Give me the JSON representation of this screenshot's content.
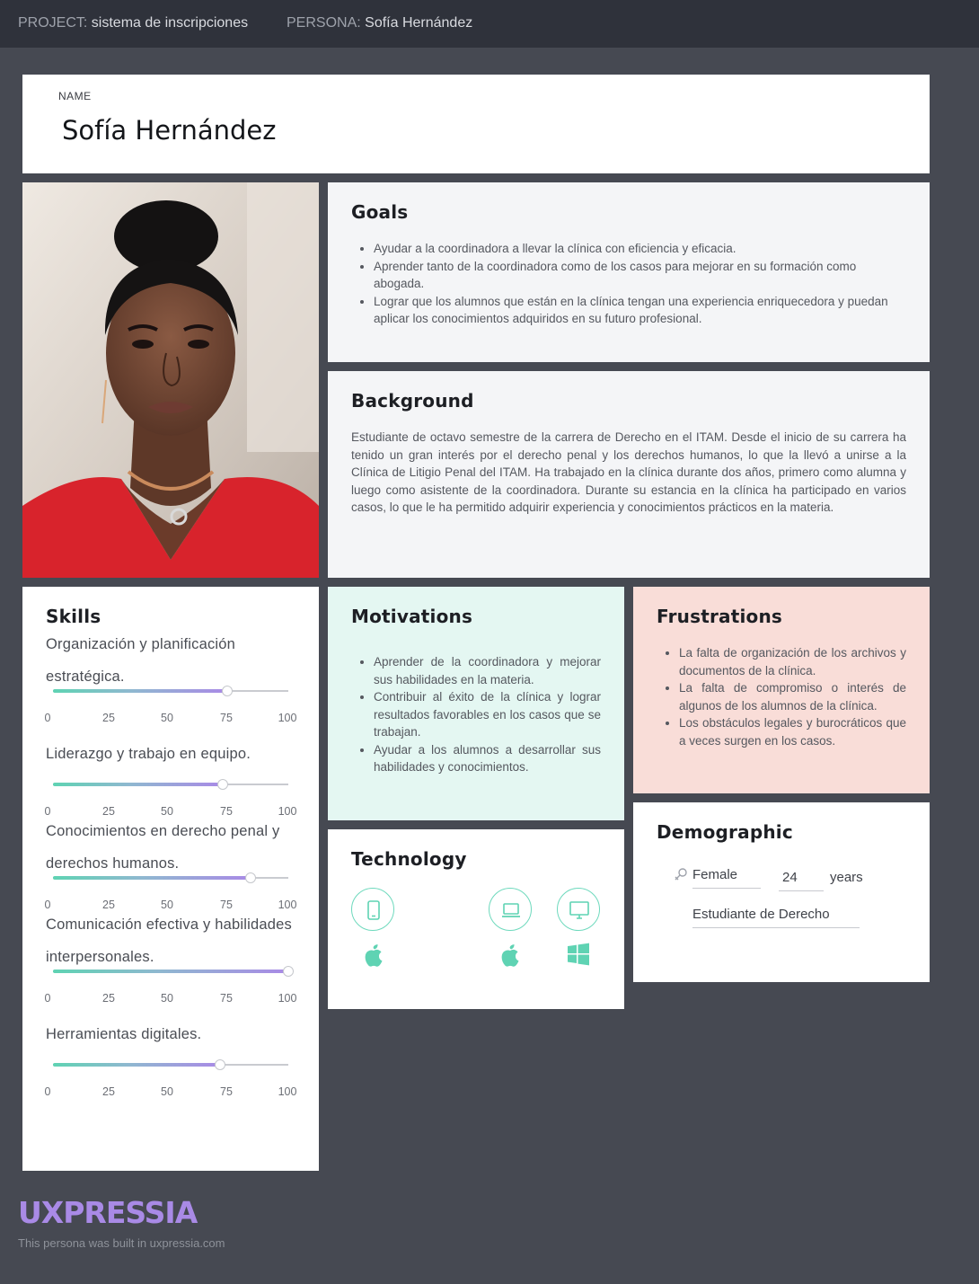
{
  "header": {
    "project_key": "PROJECT:",
    "project_value": "sistema de inscripciones",
    "persona_key": "PERSONA:",
    "persona_value": "Sofía Hernández"
  },
  "name_card": {
    "label": "NAME",
    "value": "Sofía Hernández"
  },
  "goals": {
    "title": "Goals",
    "items": [
      "Ayudar a la coordinadora a llevar la clínica con eficiencia y eficacia.",
      "Aprender tanto de la coordinadora como de los casos para mejorar en su formación como abogada.",
      "Lograr que los alumnos que están en la clínica tengan una experiencia enriquecedora y puedan aplicar los conocimientos adquiridos en su futuro profesional."
    ]
  },
  "background": {
    "title": "Background",
    "text": "Estudiante de octavo semestre de la carrera de Derecho en el ITAM. Desde el inicio de su carrera ha tenido un gran interés por el derecho penal y los derechos humanos, lo que la llevó a unirse a la Clínica de Litigio Penal del ITAM. Ha trabajado en la clínica durante dos años, primero como alumna y luego como asistente de la coordinadora. Durante su estancia en la clínica ha participado en varios casos, lo que le ha permitido adquirir experiencia y conocimientos prácticos en la materia."
  },
  "skills": {
    "title": "Skills",
    "scale": [
      "0",
      "25",
      "50",
      "75",
      "100"
    ],
    "items": [
      {
        "label": "Organización y planificación estratégica.",
        "value": 74
      },
      {
        "label": "Liderazgo y trabajo en equipo.",
        "value": 72
      },
      {
        "label": "Conocimientos en derecho penal y derechos humanos.",
        "value": 84
      },
      {
        "label": "Comunicación efectiva y habilidades interpersonales.",
        "value": 100
      },
      {
        "label": "Herramientas digitales.",
        "value": 71
      }
    ]
  },
  "motivations": {
    "title": "Motivations",
    "items": [
      "Aprender de la coordinadora y mejorar sus habilidades en la materia.",
      "Contribuir al éxito de la clínica y lograr resultados favorables en los casos que se trabajan.",
      "Ayudar a los alumnos a desarrollar sus habilidades y conocimientos."
    ]
  },
  "frustrations": {
    "title": "Frustrations",
    "items": [
      "La falta de organización de los archivos y documentos de la clínica.",
      "La falta de compromiso o interés de algunos de los alumnos de la clínica.",
      "Los obstáculos legales y burocráticos que a veces surgen en los casos."
    ]
  },
  "technology": {
    "title": "Technology",
    "devices": [
      "mobile-icon",
      "laptop-icon",
      "desktop-icon"
    ],
    "platforms": [
      "apple-icon",
      "apple-icon",
      "windows-icon"
    ],
    "accent": "#5fd3b3"
  },
  "demographic": {
    "title": "Demographic",
    "gender": "Female",
    "age": "24",
    "age_unit": "years",
    "occupation": "Estudiante de Derecho"
  },
  "footer": {
    "logo": "UXPRESSIA",
    "note": "This persona was built in uxpressia.com"
  },
  "colors": {
    "page_bg": "#464952",
    "header_bg": "#2f323b",
    "motivations_bg": "#e4f7f2",
    "frustrations_bg": "#f9ddd8",
    "brand": "#a98ae6"
  }
}
